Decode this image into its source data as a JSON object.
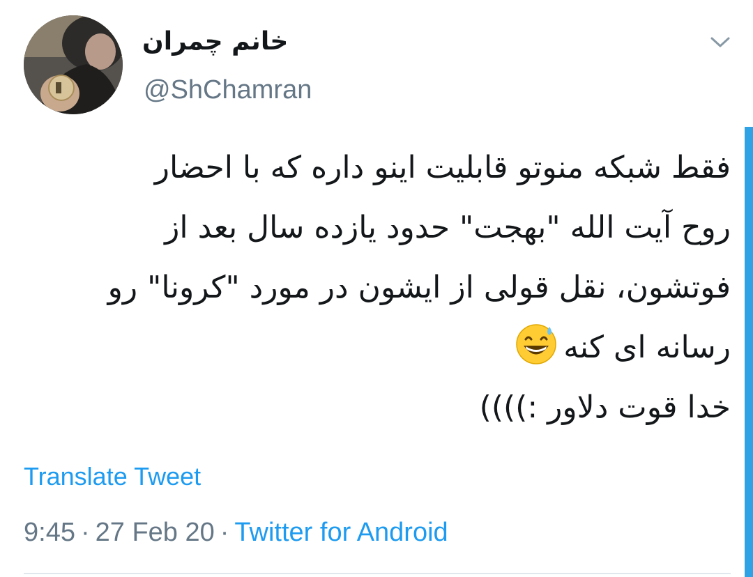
{
  "tweet": {
    "display_name": "خانم چمران",
    "username": "@ShChamran",
    "text_lines": [
      "فقط شبکه منوتو قابلیت اینو داره که با احضار",
      "روح آیت الله \"بهجت\" حدود یازده سال بعد از",
      "فوتشون، نقل قولی از ایشون در مورد \"کرونا\" رو",
      "رسانه ای کنه",
      "خدا قوت دلاور :))))"
    ],
    "emoji": "grinning-face-with-sweat",
    "translate_label": "Translate Tweet",
    "time": "9:45",
    "date": "27 Feb 20",
    "separator": "·",
    "source": "Twitter for Android"
  },
  "icons": {
    "menu": "chevron-down-icon"
  },
  "colors": {
    "link": "#1d9bf0",
    "secondary_text": "#657786",
    "primary_text": "#14171a",
    "scrollbar": "#2fa2e6"
  }
}
